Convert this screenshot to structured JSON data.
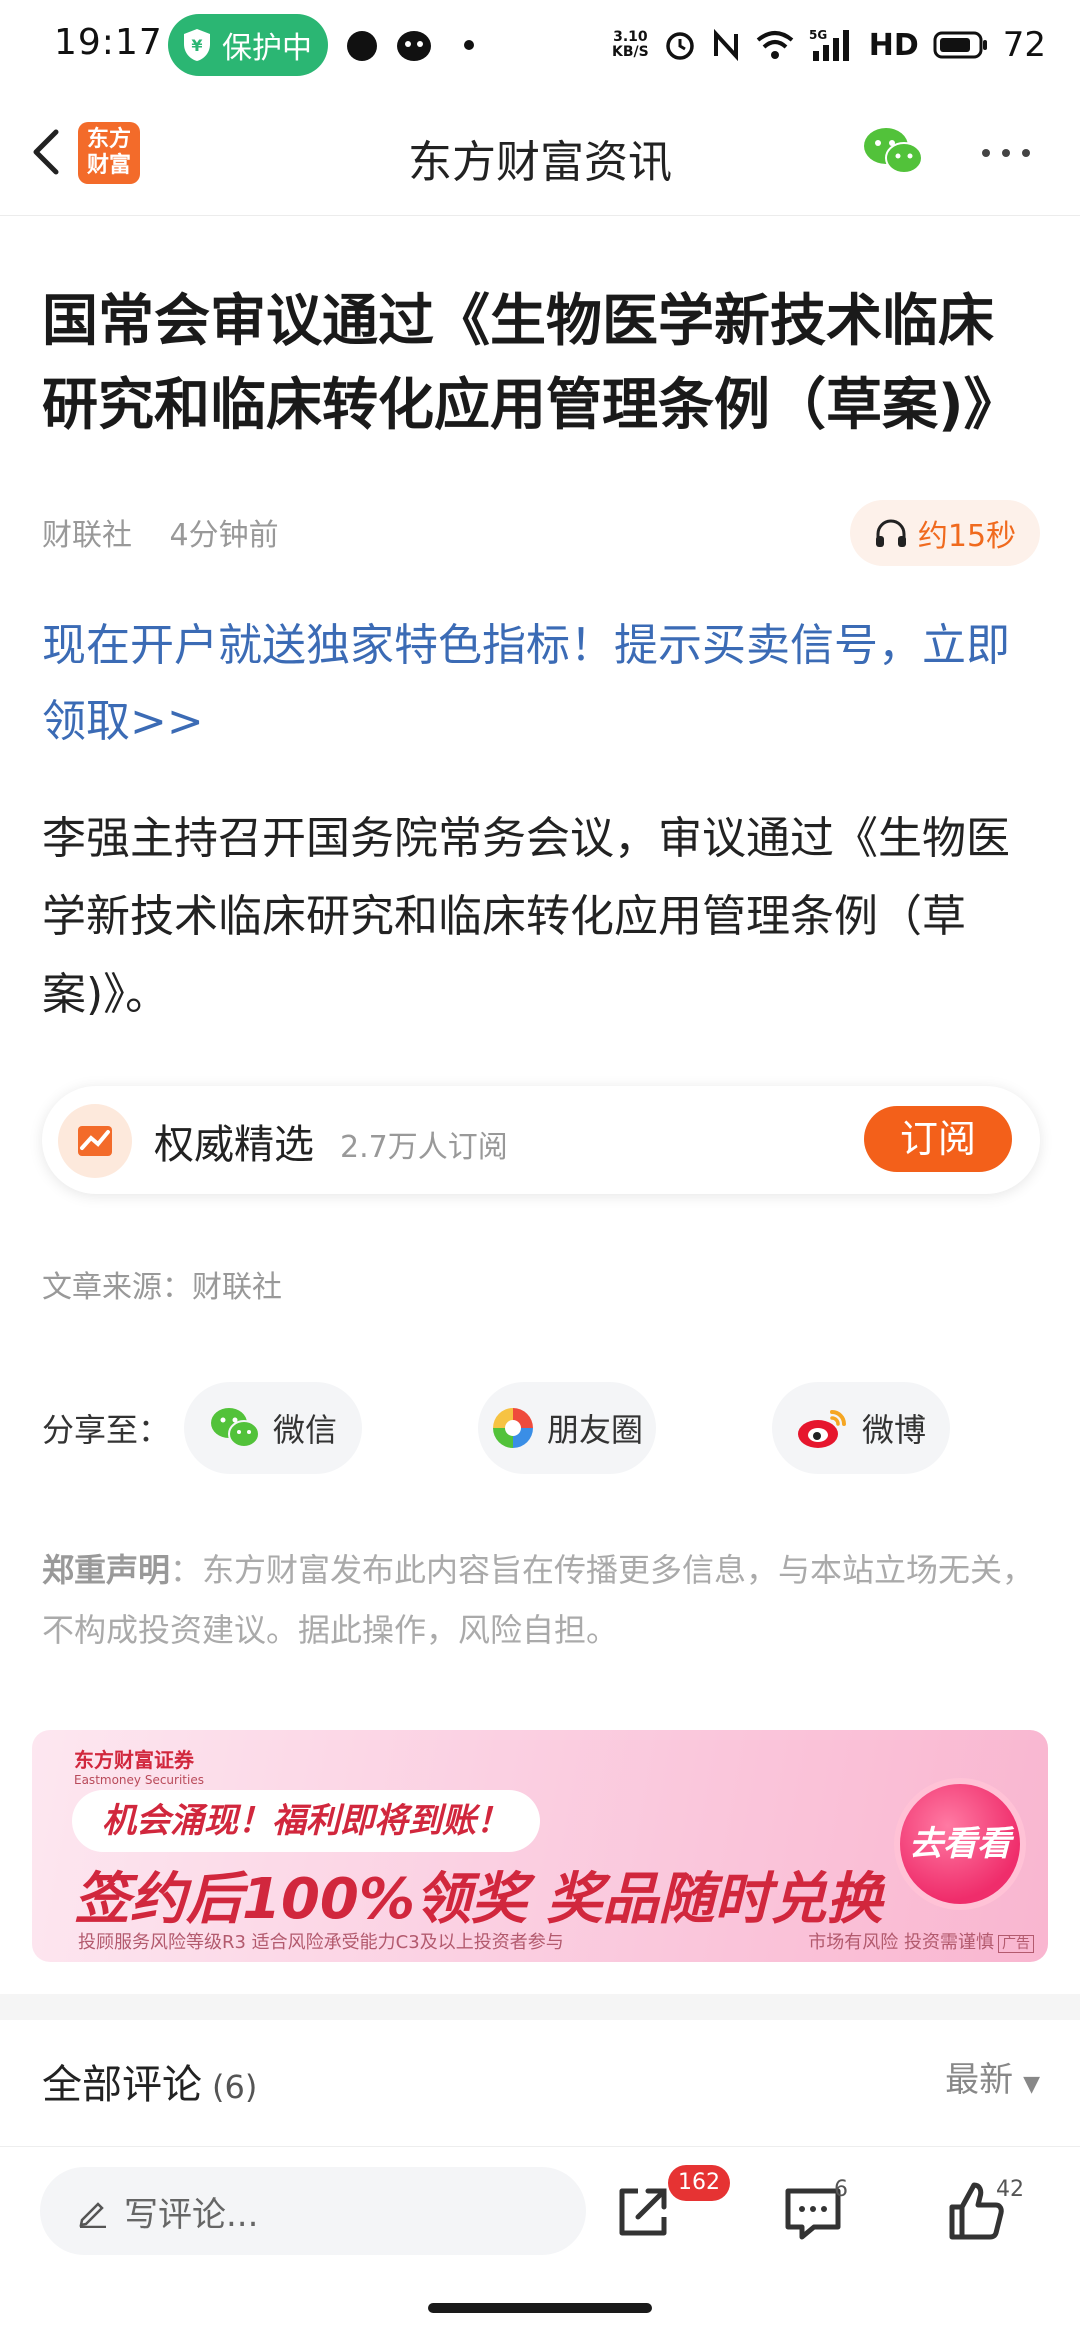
{
  "status_bar": {
    "time": "19:17",
    "protect_label": "保护中",
    "net_speed_value": "3.10",
    "net_speed_unit": "KB/S",
    "network": "5G",
    "hd": "HD",
    "battery": "72"
  },
  "nav": {
    "title": "东方财富资讯",
    "logo_text": "东方财富"
  },
  "article": {
    "title": "国常会审议通过《生物医学新技术临床研究和临床转化应用管理条例（草案)》",
    "source_name": "财联社",
    "time_ago": "4分钟前",
    "audio_label": "约15秒",
    "promo": "现在开户就送独家特色指标！提示买卖信号，立即领取>>",
    "body": "李强主持召开国务院常务会议，审议通过《生物医学新技术临床研究和临床转化应用管理条例（草案)》。"
  },
  "subscribe": {
    "channel": "权威精选",
    "subscribers": "2.7万人订阅",
    "button": "订阅"
  },
  "source_line": "文章来源：财联社",
  "share": {
    "label": "分享至：",
    "wechat": "微信",
    "moments": "朋友圈",
    "weibo": "微博"
  },
  "disclaimer": {
    "bold": "郑重声明",
    "text": "：东方财富发布此内容旨在传播更多信息，与本站立场无关，不构成投资建议。据此操作，风险自担。"
  },
  "ad": {
    "brand": "东方财富证券",
    "brand_en": "Eastmoney Securities",
    "line1": "机会涌现！福利即将到账！",
    "line2": "签约后100%领奖 奖品随时兑换",
    "fine_print": "投顾服务风险等级R3 适合风险承受能力C3及以上投资者参与",
    "risk": "市场有风险 投资需谨慎",
    "ad_tag": "广告",
    "cta": "去看看"
  },
  "comments": {
    "title": "全部评论",
    "count": "(6)",
    "sort": "最新"
  },
  "bottom_bar": {
    "input_placeholder": "写评论...",
    "share_count": "162",
    "comment_count": "6",
    "like_count": "42"
  },
  "colors": {
    "accent": "#f3601a",
    "link": "#3b6bb5",
    "protect": "#2bb673",
    "badge": "#e63333"
  }
}
